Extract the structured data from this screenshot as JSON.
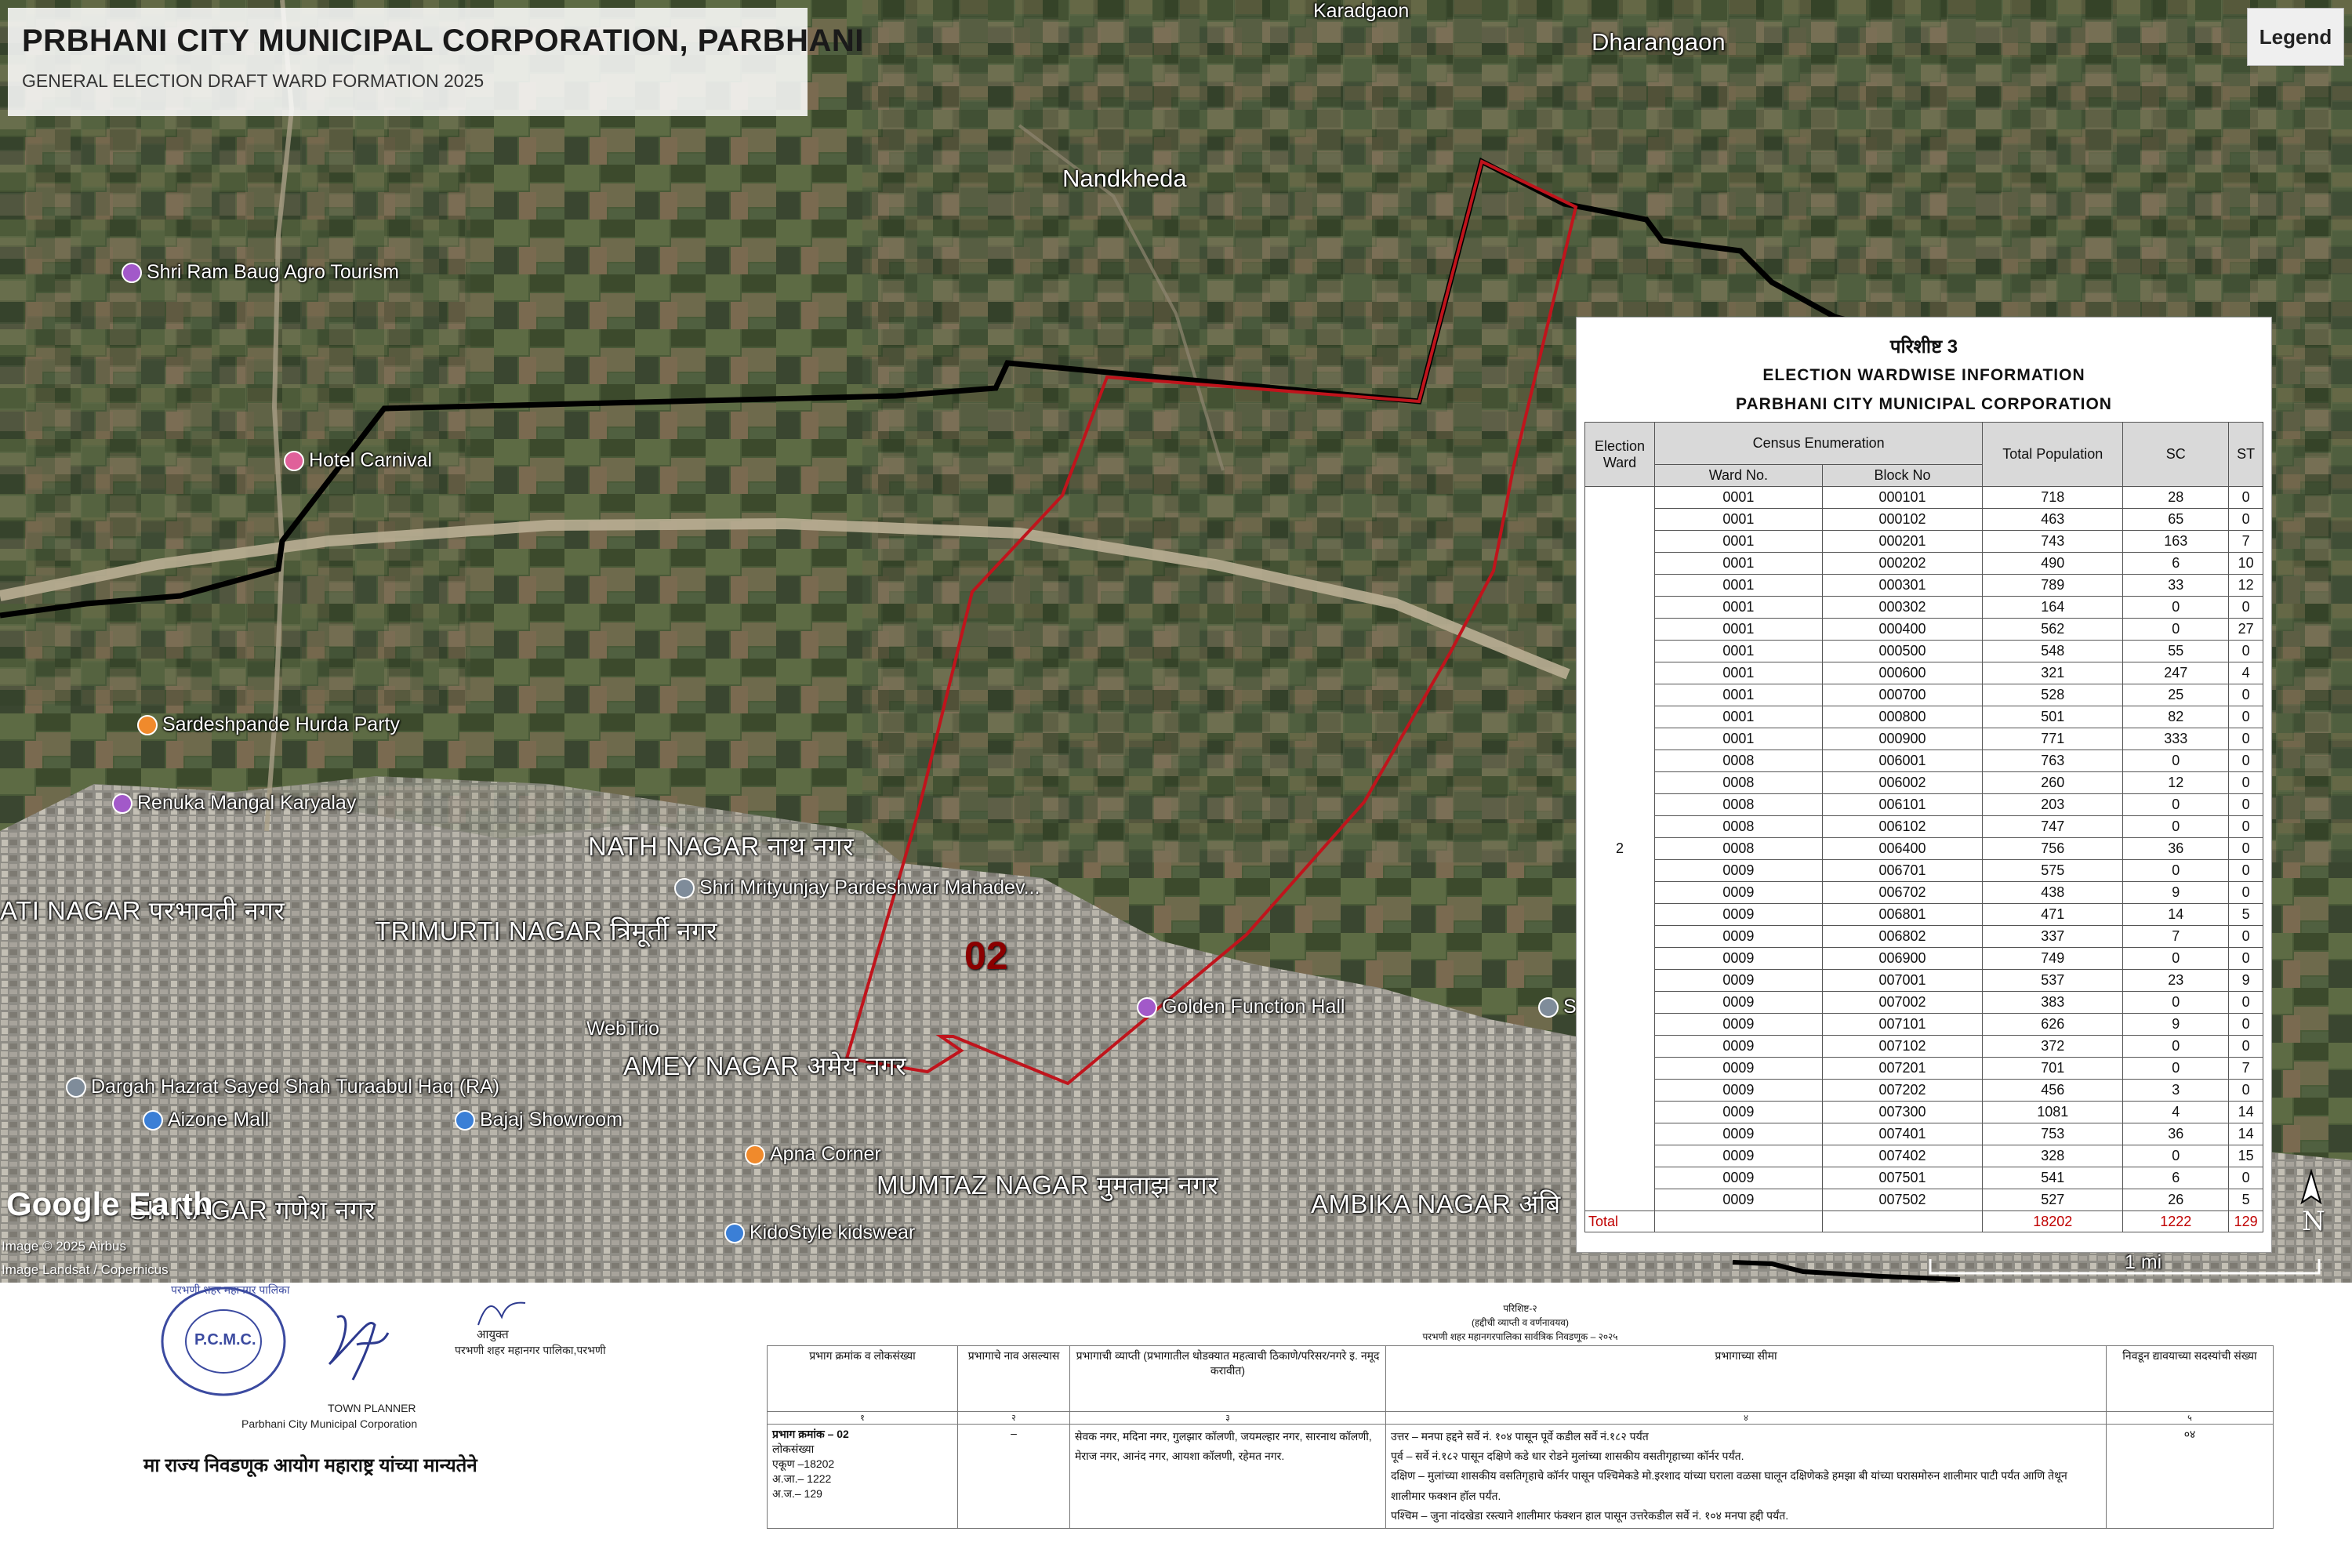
{
  "title": {
    "main": "PRBHANI CITY MUNICIPAL CORPORATION, PARBHANI",
    "sub": "GENERAL ELECTION DRAFT WARD FORMATION 2025"
  },
  "legend_label": "Legend",
  "map": {
    "ward_number": "02",
    "place_labels": {
      "karadgaon": "Karadgaon",
      "dharangaon": "Dharangaon",
      "nandkheda": "Nandkheda",
      "shri_ram_baug": "Shri Ram Baug Agro Tourism",
      "hotel_carnival": "Hotel Carnival",
      "sardeshpande": "Sardeshpande Hurda Party",
      "renuka": "Renuka Mangal Karyalay",
      "nath_nagar": "NATH NAGAR नाथ नगर",
      "parbhavati": "ATI NAGAR परभावती नगर",
      "mrityunjay": "Shri Mrityunjay Pardeshwar Mahadev...",
      "trimurti": "TRIMURTI NAGAR त्रिमूर्ती नगर",
      "webtrio": "WebTrio",
      "golden": "Golden Function Hall",
      "amey": "AMEY NAGAR अमेय नगर",
      "dargah": "Dargah Hazrat Sayed Shah Turaabul Haq (RA)",
      "aizone": "Aizone Mall",
      "bajaj": "Bajaj Showroom",
      "apna": "Apna Corner",
      "mumtaz": "MUMTAZ NAGAR मुमताझ नगर",
      "ambika": "AMBIKA NAGAR अंबि",
      "ganesh": "SH NAGAR गणेश नगर",
      "kidostyle": "KidoStyle kidswear",
      "sa": "Sa"
    },
    "google_logo": "Google Earth",
    "credits": [
      "Image © 2025 Airbus",
      "Image Landsat / Copernicus"
    ],
    "scale_label": "1 mi",
    "north_label": "N",
    "colors": {
      "ward_boundary": "#c0141c",
      "city_boundary": "#000000"
    }
  },
  "info_table": {
    "heading_marathi": "परिशीष्ट 3",
    "heading_1": "ELECTION WARDWISE INFORMATION",
    "heading_2": "PARBHANI CITY MUNICIPAL CORPORATION",
    "headers": {
      "election_ward": "Election Ward",
      "census": "Census Enumeration",
      "ward_no": "Ward No.",
      "block_no": "Block No",
      "total_population": "Total Population",
      "sc": "SC",
      "st": "ST"
    },
    "ward": "2",
    "rows": [
      [
        "0001",
        "000101",
        "718",
        "28",
        "0"
      ],
      [
        "0001",
        "000102",
        "463",
        "65",
        "0"
      ],
      [
        "0001",
        "000201",
        "743",
        "163",
        "7"
      ],
      [
        "0001",
        "000202",
        "490",
        "6",
        "10"
      ],
      [
        "0001",
        "000301",
        "789",
        "33",
        "12"
      ],
      [
        "0001",
        "000302",
        "164",
        "0",
        "0"
      ],
      [
        "0001",
        "000400",
        "562",
        "0",
        "27"
      ],
      [
        "0001",
        "000500",
        "548",
        "55",
        "0"
      ],
      [
        "0001",
        "000600",
        "321",
        "247",
        "4"
      ],
      [
        "0001",
        "000700",
        "528",
        "25",
        "0"
      ],
      [
        "0001",
        "000800",
        "501",
        "82",
        "0"
      ],
      [
        "0001",
        "000900",
        "771",
        "333",
        "0"
      ],
      [
        "0008",
        "006001",
        "763",
        "0",
        "0"
      ],
      [
        "0008",
        "006002",
        "260",
        "12",
        "0"
      ],
      [
        "0008",
        "006101",
        "203",
        "0",
        "0"
      ],
      [
        "0008",
        "006102",
        "747",
        "0",
        "0"
      ],
      [
        "0008",
        "006400",
        "756",
        "36",
        "0"
      ],
      [
        "0009",
        "006701",
        "575",
        "0",
        "0"
      ],
      [
        "0009",
        "006702",
        "438",
        "9",
        "0"
      ],
      [
        "0009",
        "006801",
        "471",
        "14",
        "5"
      ],
      [
        "0009",
        "006802",
        "337",
        "7",
        "0"
      ],
      [
        "0009",
        "006900",
        "749",
        "0",
        "0"
      ],
      [
        "0009",
        "007001",
        "537",
        "23",
        "9"
      ],
      [
        "0009",
        "007002",
        "383",
        "0",
        "0"
      ],
      [
        "0009",
        "007101",
        "626",
        "9",
        "0"
      ],
      [
        "0009",
        "007102",
        "372",
        "0",
        "0"
      ],
      [
        "0009",
        "007201",
        "701",
        "0",
        "7"
      ],
      [
        "0009",
        "007202",
        "456",
        "3",
        "0"
      ],
      [
        "0009",
        "007300",
        "1081",
        "4",
        "14"
      ],
      [
        "0009",
        "007401",
        "753",
        "36",
        "14"
      ],
      [
        "0009",
        "007402",
        "328",
        "0",
        "15"
      ],
      [
        "0009",
        "007501",
        "541",
        "6",
        "0"
      ],
      [
        "0009",
        "007502",
        "527",
        "26",
        "5"
      ]
    ],
    "total_label": "Total",
    "total_population": "18202",
    "total_sc": "1222",
    "total_st": "129"
  },
  "signatures": {
    "seal_text": "P.C.M.C.",
    "seal_ring": "परभणी शहर महानगर पालिका",
    "town_planner": "TOWN PLANNER",
    "town_planner_org": "Parbhani City Municipal Corporation",
    "commissioner": "आयुक्त",
    "commissioner_org": "परभणी शहर महानगर पालिका,परभणी",
    "approval": "मा राज्य निवडणूक आयोग महाराष्ट्र यांच्या मान्यतेने"
  },
  "ward_description": {
    "title_1": "परिशिष्ट-२",
    "title_2": "(हद्दीची व्याप्ती व वर्णनावयव)",
    "title_3": "परभणी शहर महानगरपालिका सार्वत्रिक निवडणूक – २०२५",
    "headers": [
      "प्रभाग क्रमांक व लोकसंख्या",
      "प्रभागाचे नाव असल्यास",
      "प्रभागाची व्याप्ती (प्रभागातील थोडक्यात महत्वाची ठिकाणे/परिसर/नगरे इ. नमूद करावीत)",
      "प्रभागाच्या सीमा",
      "निवडून द्यावयाच्या सदस्यांची संख्या"
    ],
    "col_numbers": [
      "१",
      "२",
      "३",
      "४",
      "५"
    ],
    "ward_heading": "प्रभाग क्रमांक – 02",
    "population_label": "लोकसंख्या",
    "population_total": "एकूण –18202",
    "population_sc": "अ.जा.–  1222",
    "population_st": "अ.ज.– 129",
    "name": "–",
    "extent": "सेवक नगर, मदिना नगर, गुलझार कॉलणी, जयमल्हार नगर, सारनाथ कॉलणी, मेराज नगर, आनंद नगर, आयशा कॉलणी, रहेमत नगर.",
    "boundary_north": "उत्तर – मनपा हद्दने सर्वे नं. १०४ पासून पूर्वे कडील सर्वे नं.१८२ पर्यंत",
    "boundary_east": "पूर्व – सर्वे नं.१८२ पासून दक्षिणे कडे धार रोडने मुलांच्या शासकीय वसतीगृहाच्या कॉर्नर पर्यंत.",
    "boundary_south": "दक्षिण – मुलांच्या शासकीय वसतिगृहाचे कॉर्नर पासून पश्चिमेकडे मो.इरशाद यांच्या घराला वळसा घालून दक्षिणेकडे हमझा बी यांच्या घरासमोरुन शालीमार पाटी पर्यंत आणि तेथून शालीमार फक्शन हॉल पर्यंत.",
    "boundary_west": "पश्चिम – जुना नांदखेडा रस्त्याने शालीमार फंक्शन हाल पासून उत्तरेकडील  सर्वे नं. १०४ मनपा हद्दी पर्यंत.",
    "members": "०४"
  }
}
